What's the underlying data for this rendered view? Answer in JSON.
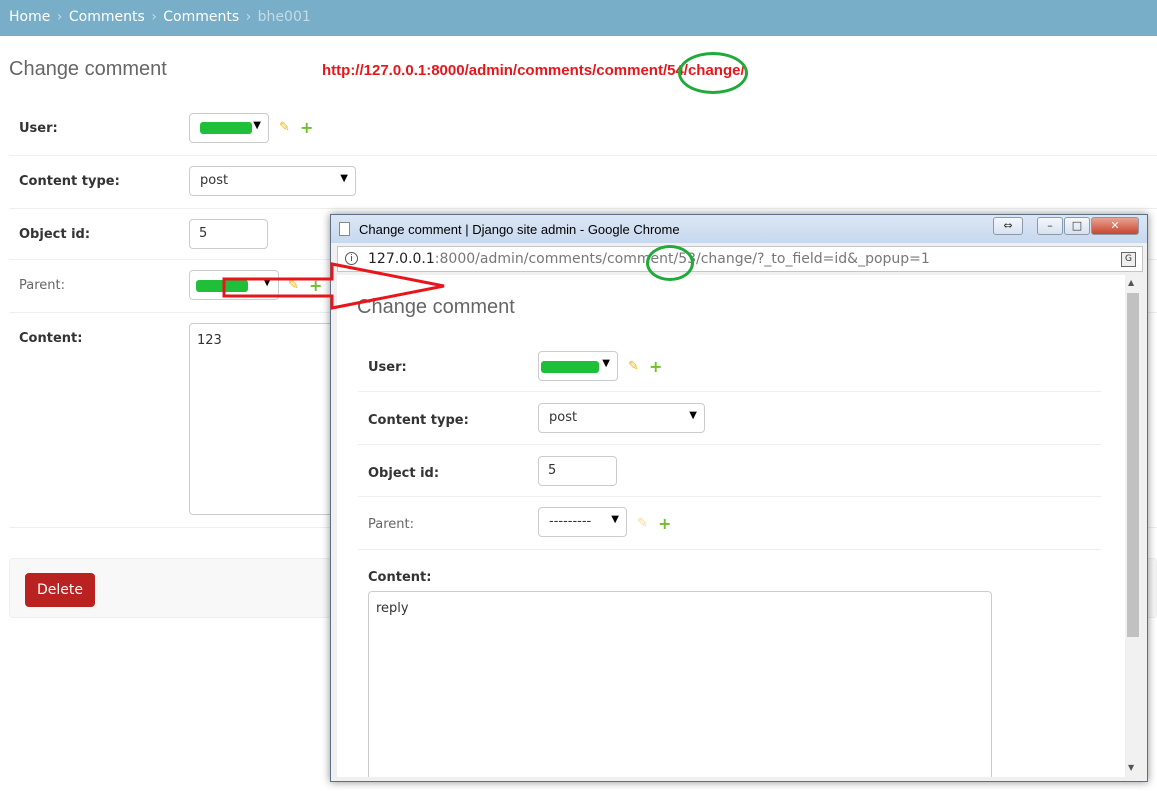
{
  "breadcrumbs": [
    "Home",
    "Comments",
    "Comments",
    "bhe001"
  ],
  "breadcrumb_sep": "›",
  "main": {
    "title": "Change comment",
    "annotation_url": "http://127.0.0.1:8000/admin/comments/comment/54/change/",
    "fields": {
      "user_label": "User:",
      "content_type_label": "Content type:",
      "content_type_value": "post",
      "object_id_label": "Object id:",
      "object_id_value": "5",
      "parent_label": "Parent:",
      "content_label": "Content:",
      "content_value": "123"
    },
    "delete_label": "Delete"
  },
  "popup": {
    "window_title": "Change comment | Django site admin - Google Chrome",
    "url_host": "127.0.0.1",
    "url_rest": ":8000/admin/comments/comment/53/change/?_to_field=id&_popup=1",
    "title": "Change comment",
    "fields": {
      "user_label": "User:",
      "content_type_label": "Content type:",
      "content_type_value": "post",
      "object_id_label": "Object id:",
      "object_id_value": "5",
      "parent_label": "Parent:",
      "parent_value": "---------",
      "content_label": "Content:",
      "content_value": "reply"
    }
  },
  "colors": {
    "header": "#79aec8",
    "delete": "#ba2121",
    "annotation_red": "#e8161b",
    "annotation_green": "#1faa3a",
    "add_icon": "#70bf2b",
    "edit_icon": "#efb80b"
  },
  "icons": {
    "edit": "pencil-icon",
    "add": "plus-icon",
    "caret": "caret-down-icon"
  }
}
